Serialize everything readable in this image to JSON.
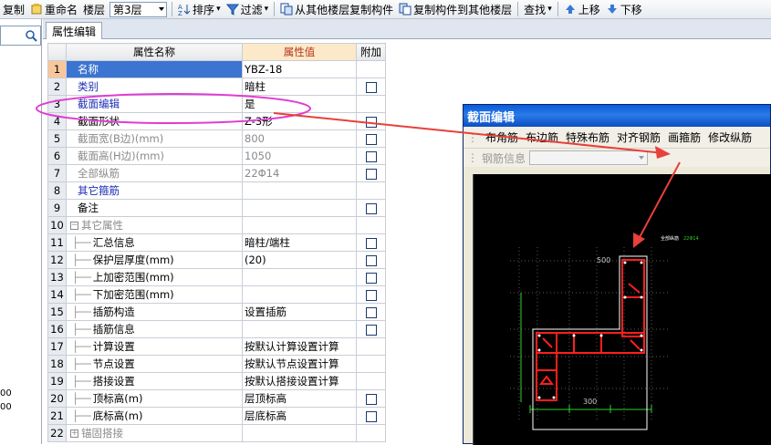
{
  "toolbar": {
    "copy": "复制",
    "rename": "重命名",
    "floor_label": "楼层",
    "floor_value": "第3层",
    "sort": "排序",
    "filter": "过滤",
    "copy_from": "从其他楼层复制构件",
    "copy_to": "复制构件到其他楼层",
    "find": "查找",
    "move_up": "上移",
    "move_down": "下移"
  },
  "left_panel": {
    "texts": [
      "00",
      "00"
    ]
  },
  "tabs": [
    {
      "label": "属性编辑"
    }
  ],
  "grid": {
    "headers": {
      "name": "属性名称",
      "value": "属性值",
      "extra": "附加"
    },
    "rows": [
      {
        "num": "1",
        "name": "名称",
        "value": "YBZ-18",
        "check": false,
        "style": "sel"
      },
      {
        "num": "2",
        "name": "类别",
        "value": "暗柱",
        "check": true,
        "style": "blue"
      },
      {
        "num": "3",
        "name": "截面编辑",
        "value": "是",
        "check": false,
        "style": "blue"
      },
      {
        "num": "4",
        "name": "截面形状",
        "value": "Z-3形",
        "check": true,
        "style": ""
      },
      {
        "num": "5",
        "name": "截面宽(B边)(mm)",
        "value": "800",
        "check": true,
        "style": "gray"
      },
      {
        "num": "6",
        "name": "截面高(H边)(mm)",
        "value": "1050",
        "check": true,
        "style": "gray"
      },
      {
        "num": "7",
        "name": "全部纵筋",
        "value": "22Φ14",
        "check": true,
        "style": "gray"
      },
      {
        "num": "8",
        "name": "其它箍筋",
        "value": "",
        "check": false,
        "style": "blue"
      },
      {
        "num": "9",
        "name": "备注",
        "value": "",
        "check": true,
        "style": ""
      },
      {
        "num": "10",
        "name": "其它属性",
        "value": "",
        "check": false,
        "style": "tree-minus"
      },
      {
        "num": "11",
        "name": "汇总信息",
        "value": "暗柱/端柱",
        "check": true,
        "style": "child"
      },
      {
        "num": "12",
        "name": "保护层厚度(mm)",
        "value": "(20)",
        "check": true,
        "style": "child"
      },
      {
        "num": "13",
        "name": "上加密范围(mm)",
        "value": "",
        "check": true,
        "style": "child"
      },
      {
        "num": "14",
        "name": "下加密范围(mm)",
        "value": "",
        "check": true,
        "style": "child"
      },
      {
        "num": "15",
        "name": "插筋构造",
        "value": "设置插筋",
        "check": true,
        "style": "child"
      },
      {
        "num": "16",
        "name": "插筋信息",
        "value": "",
        "check": true,
        "style": "child"
      },
      {
        "num": "17",
        "name": "计算设置",
        "value": "按默认计算设置计算",
        "check": false,
        "style": "child"
      },
      {
        "num": "18",
        "name": "节点设置",
        "value": "按默认节点设置计算",
        "check": false,
        "style": "child"
      },
      {
        "num": "19",
        "name": "搭接设置",
        "value": "按默认搭接设置计算",
        "check": false,
        "style": "child"
      },
      {
        "num": "20",
        "name": "顶标高(m)",
        "value": "层顶标高",
        "check": true,
        "style": "child"
      },
      {
        "num": "21",
        "name": "底标高(m)",
        "value": "层底标高",
        "check": true,
        "style": "child"
      },
      {
        "num": "22",
        "name": "锚固搭接",
        "value": "",
        "check": false,
        "style": "tree-plus"
      }
    ]
  },
  "popup": {
    "title": "截面编辑",
    "menu": [
      "布角筋",
      "布边筋",
      "特殊布筋",
      "对齐钢筋",
      "画箍筋",
      "修改纵筋"
    ],
    "rebar_info_label": "钢筋信息",
    "dims": {
      "top": "500",
      "bottom": "300"
    },
    "legend": [
      "全部纵筋",
      "22Φ14"
    ]
  },
  "colors": {
    "annotation": "#e03cd3",
    "arrow": "#e8403a",
    "selection": "#3b74d1",
    "value_header": "#b8341b"
  }
}
